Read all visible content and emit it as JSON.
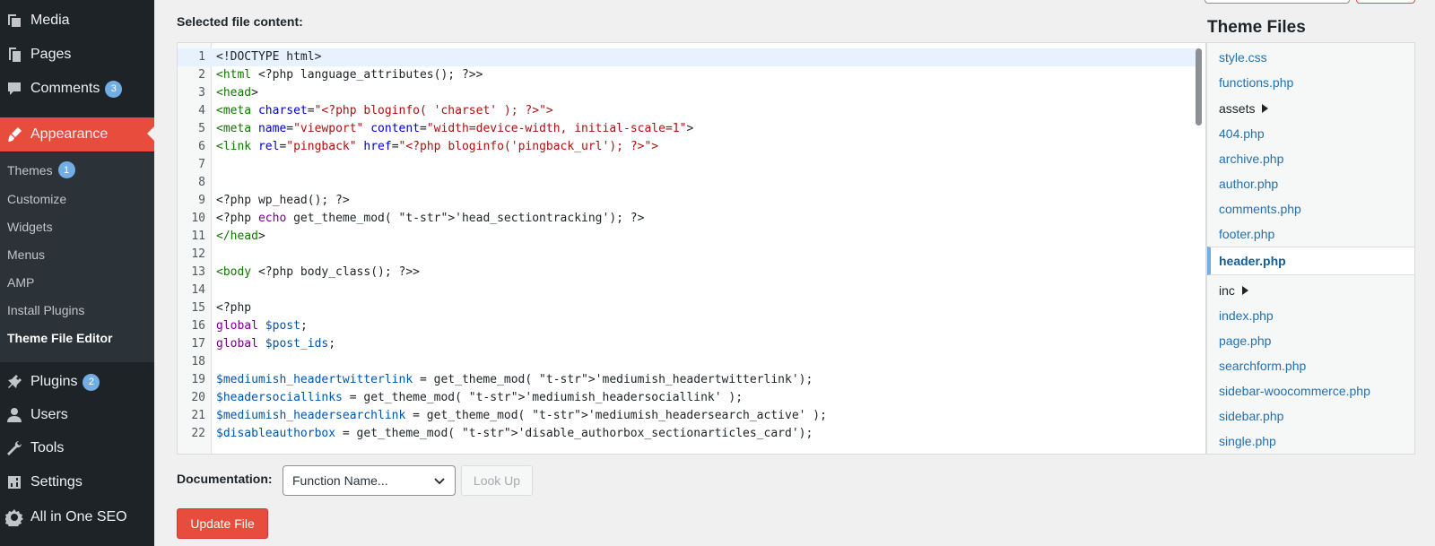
{
  "sidebar": {
    "menu": [
      {
        "label": "Media",
        "icon": "media-icon"
      },
      {
        "label": "Pages",
        "icon": "pages-icon"
      },
      {
        "label": "Comments",
        "icon": "comments-icon",
        "badge": "3"
      },
      {
        "label": "Appearance",
        "icon": "paintbrush-icon",
        "active": true
      },
      {
        "label": "Plugins",
        "icon": "plugin-icon",
        "badge": "2"
      },
      {
        "label": "Users",
        "icon": "user-icon"
      },
      {
        "label": "Tools",
        "icon": "wrench-icon"
      },
      {
        "label": "Settings",
        "icon": "settings-icon"
      },
      {
        "label": "All in One SEO",
        "icon": "seo-gear-icon"
      }
    ],
    "submenu": [
      {
        "label": "Themes",
        "badge": "1"
      },
      {
        "label": "Customize"
      },
      {
        "label": "Widgets"
      },
      {
        "label": "Menus"
      },
      {
        "label": "AMP"
      },
      {
        "label": "Install Plugins"
      },
      {
        "label": "Theme File Editor",
        "current": true
      }
    ]
  },
  "editor": {
    "label": "Selected file content:",
    "lines": [
      {
        "n": "1",
        "code": "<!DOCTYPE html>"
      },
      {
        "n": "2",
        "code": "<html <?php language_attributes(); ?>>"
      },
      {
        "n": "3",
        "code": "<head>"
      },
      {
        "n": "4",
        "code": "<meta charset=\"<?php bloginfo( 'charset' ); ?>\">"
      },
      {
        "n": "5",
        "code": "<meta name=\"viewport\" content=\"width=device-width, initial-scale=1\">"
      },
      {
        "n": "6",
        "code": "<link rel=\"pingback\" href=\"<?php bloginfo('pingback_url'); ?>\">"
      },
      {
        "n": "7",
        "code": ""
      },
      {
        "n": "8",
        "code": ""
      },
      {
        "n": "9",
        "code": "<?php wp_head(); ?>"
      },
      {
        "n": "10",
        "code": "<?php echo get_theme_mod( 'head_sectiontracking'); ?>"
      },
      {
        "n": "11",
        "code": "</head>"
      },
      {
        "n": "12",
        "code": ""
      },
      {
        "n": "13",
        "code": "<body <?php body_class(); ?>>"
      },
      {
        "n": "14",
        "code": ""
      },
      {
        "n": "15",
        "code": "<?php"
      },
      {
        "n": "16",
        "code": "global $post;"
      },
      {
        "n": "17",
        "code": "global $post_ids;"
      },
      {
        "n": "18",
        "code": ""
      },
      {
        "n": "19",
        "code": "$mediumish_headertwitterlink = get_theme_mod( 'mediumish_headertwitterlink');"
      },
      {
        "n": "20",
        "code": "$headersociallinks = get_theme_mod( 'mediumish_headersociallink' );"
      },
      {
        "n": "21",
        "code": "$mediumish_headersearchlink = get_theme_mod( 'mediumish_headersearch_active' );"
      },
      {
        "n": "22",
        "code": "$disableauthorbox = get_theme_mod( 'disable_authorbox_sectionarticles_card');"
      }
    ]
  },
  "theme_files": {
    "title": "Theme Files",
    "items": [
      {
        "label": "style.css"
      },
      {
        "label": "functions.php"
      },
      {
        "label": "assets",
        "folder": true
      },
      {
        "label": "404.php"
      },
      {
        "label": "archive.php"
      },
      {
        "label": "author.php"
      },
      {
        "label": "comments.php"
      },
      {
        "label": "footer.php"
      },
      {
        "label": "header.php",
        "current": true
      },
      {
        "label": "inc",
        "folder": true
      },
      {
        "label": "index.php"
      },
      {
        "label": "page.php"
      },
      {
        "label": "searchform.php"
      },
      {
        "label": "sidebar-woocommerce.php"
      },
      {
        "label": "sidebar.php"
      },
      {
        "label": "single.php"
      }
    ]
  },
  "documentation": {
    "label": "Documentation:",
    "select_value": "Function Name...",
    "lookup_label": "Look Up"
  },
  "update_label": "Update File",
  "colors": {
    "accent": "#e74c3c",
    "sidebar_bg": "#1d2327",
    "submenu_bg": "#2c3338",
    "link": "#2271b1",
    "badge": "#72aee6"
  }
}
